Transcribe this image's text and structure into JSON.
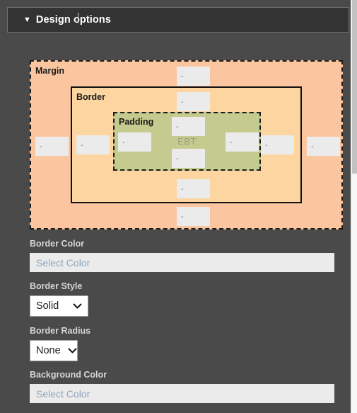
{
  "panel": {
    "header": {
      "caret_icon": "triangle-down-icon",
      "title": "Design options"
    }
  },
  "box_model": {
    "margin": {
      "label": "Margin",
      "color": "#FBC69F",
      "inputs": {
        "top": {
          "value": "",
          "placeholder": "-"
        },
        "right": {
          "value": "",
          "placeholder": "-"
        },
        "bottom": {
          "value": "",
          "placeholder": "-"
        },
        "left": {
          "value": "",
          "placeholder": "-"
        }
      }
    },
    "border": {
      "label": "Border",
      "color": "#FDD5A1",
      "inputs": {
        "top": {
          "value": "",
          "placeholder": "-"
        },
        "right": {
          "value": "",
          "placeholder": "-"
        },
        "bottom": {
          "value": "",
          "placeholder": "-"
        },
        "left": {
          "value": "",
          "placeholder": "-"
        }
      }
    },
    "padding": {
      "label": "Padding",
      "color": "#C5CB8E",
      "inputs": {
        "top": {
          "value": "",
          "placeholder": "-"
        },
        "right": {
          "value": "",
          "placeholder": "-"
        },
        "bottom": {
          "value": "",
          "placeholder": "-"
        },
        "left": {
          "value": "",
          "placeholder": "-"
        }
      }
    },
    "content": {
      "text": "EBT"
    }
  },
  "fields": {
    "border_color": {
      "label": "Border Color",
      "value": "",
      "placeholder": "Select Color"
    },
    "border_style": {
      "label": "Border Style",
      "value": "Solid",
      "chevron_icon": "chevron-down-icon"
    },
    "border_radius": {
      "label": "Border Radius",
      "value": "None",
      "chevron_icon": "chevron-down-icon"
    },
    "background_color": {
      "label": "Background Color",
      "value": "",
      "placeholder": "Select Color"
    }
  },
  "scrollbar": {
    "thumb_position": "top"
  }
}
